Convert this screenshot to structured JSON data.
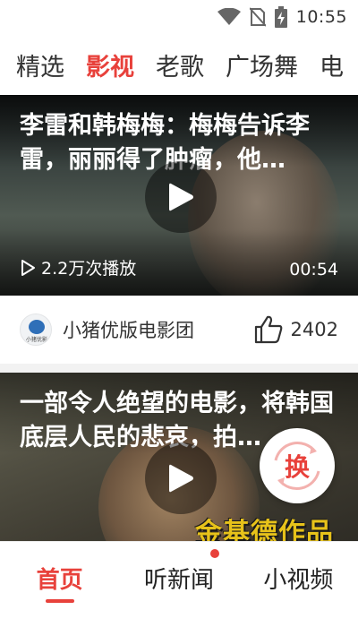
{
  "status_bar": {
    "time": "10:55",
    "icons": [
      "wifi-icon",
      "no-sim-icon",
      "battery-charging-icon"
    ]
  },
  "tabs": [
    {
      "label": "精选",
      "active": false
    },
    {
      "label": "影视",
      "active": true
    },
    {
      "label": "老歌",
      "active": false
    },
    {
      "label": "广场舞",
      "active": false
    },
    {
      "label": "电",
      "active": false
    }
  ],
  "videos": [
    {
      "title": "李雷和韩梅梅：梅梅告诉李雷，丽丽得了肿瘤，他…",
      "plays": "2.2万次播放",
      "duration": "00:54",
      "author": "小猪优版电影团",
      "avatar_text": "小猪优影",
      "likes": "2402"
    },
    {
      "title": "一部令人绝望的电影，将韩国底层人民的悲哀，拍…",
      "overlay_text": "金基德作品"
    }
  ],
  "swap_button": {
    "label": "换"
  },
  "bottom_nav": [
    {
      "label": "首页",
      "active": true
    },
    {
      "label": "听新闻",
      "active": false,
      "badge": true
    },
    {
      "label": "小视频",
      "active": false
    }
  ],
  "colors": {
    "accent": "#e8413b",
    "text": "#333333"
  }
}
